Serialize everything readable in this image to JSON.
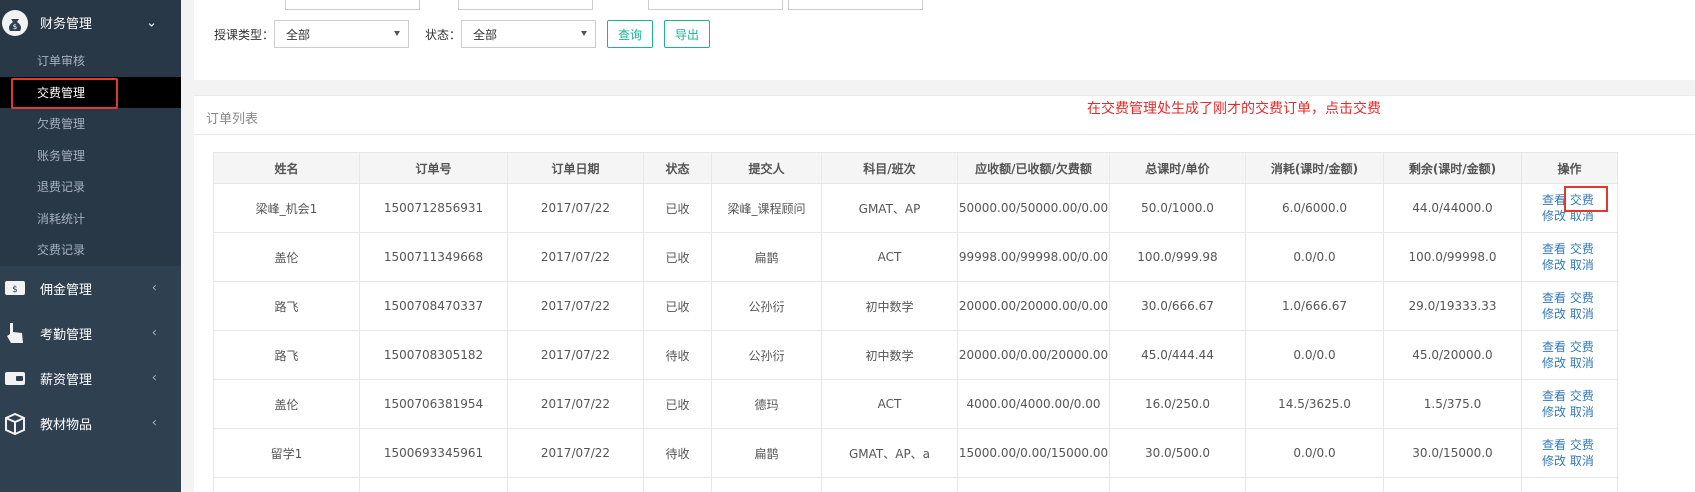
{
  "sidebar": {
    "finance": {
      "label": "财务管理",
      "items": [
        {
          "label": "订单审核"
        },
        {
          "label": "交费管理"
        },
        {
          "label": "欠费管理"
        },
        {
          "label": "账务管理"
        },
        {
          "label": "退费记录"
        },
        {
          "label": "消耗统计"
        },
        {
          "label": "交费记录"
        }
      ]
    },
    "groups": [
      {
        "label": "佣金管理"
      },
      {
        "label": "考勤管理"
      },
      {
        "label": "薪资管理"
      },
      {
        "label": "教材物品"
      }
    ]
  },
  "filters": {
    "teaching_type_label": "授课类型：",
    "teaching_type_value": "全部",
    "status_label": "状态：",
    "status_value": "全部",
    "query_label": "查询",
    "export_label": "导出"
  },
  "list": {
    "title": "订单列表",
    "annotation": "在交费管理处生成了刚才的交费订单，点击交费",
    "columns": [
      "姓名",
      "订单号",
      "订单日期",
      "状态",
      "提交人",
      "科目/班次",
      "应收额/已收额/欠费额",
      "总课时/单价",
      "消耗(课时/金额)",
      "剩余(课时/金额)",
      "操作"
    ],
    "actions": {
      "view": "查看",
      "pay": "交费",
      "edit": "修改",
      "cancel": "取消"
    },
    "rows": [
      {
        "name": "梁峰_机会1",
        "order_no": "1500712856931",
        "date": "2017/07/22",
        "status": "已收",
        "submitter": "梁峰_课程顾问",
        "subject": "GMAT、AP",
        "amounts": "50000.00/50000.00/0.00",
        "hours_price": "50.0/1000.0",
        "consumed": "6.0/6000.0",
        "remaining": "44.0/44000.0"
      },
      {
        "name": "盖伦",
        "order_no": "1500711349668",
        "date": "2017/07/22",
        "status": "已收",
        "submitter": "扁鹊",
        "subject": "ACT",
        "amounts": "99998.00/99998.00/0.00",
        "hours_price": "100.0/999.98",
        "consumed": "0.0/0.0",
        "remaining": "100.0/99998.0"
      },
      {
        "name": "路飞",
        "order_no": "1500708470337",
        "date": "2017/07/22",
        "status": "已收",
        "submitter": "公孙衍",
        "subject": "初中数学",
        "amounts": "20000.00/20000.00/0.00",
        "hours_price": "30.0/666.67",
        "consumed": "1.0/666.67",
        "remaining": "29.0/19333.33"
      },
      {
        "name": "路飞",
        "order_no": "1500708305182",
        "date": "2017/07/22",
        "status": "待收",
        "submitter": "公孙衍",
        "subject": "初中数学",
        "amounts": "20000.00/0.00/20000.00",
        "hours_price": "45.0/444.44",
        "consumed": "0.0/0.0",
        "remaining": "45.0/20000.0"
      },
      {
        "name": "盖伦",
        "order_no": "1500706381954",
        "date": "2017/07/22",
        "status": "已收",
        "submitter": "德玛",
        "subject": "ACT",
        "amounts": "4000.00/4000.00/0.00",
        "hours_price": "16.0/250.0",
        "consumed": "14.5/3625.0",
        "remaining": "1.5/375.0"
      },
      {
        "name": "留学1",
        "order_no": "1500693345961",
        "date": "2017/07/22",
        "status": "待收",
        "submitter": "扁鹊",
        "subject": "GMAT、AP、a",
        "amounts": "15000.00/0.00/15000.00",
        "hours_price": "30.0/500.0",
        "consumed": "0.0/0.0",
        "remaining": "30.0/15000.0"
      }
    ],
    "partial_row_actions": {
      "view": "查看",
      "pay": "交费"
    }
  },
  "colors": {
    "sidebar_bg": "#2f4050",
    "accent": "#1ab394",
    "highlight": "#e0392f",
    "link": "#337ab7"
  }
}
